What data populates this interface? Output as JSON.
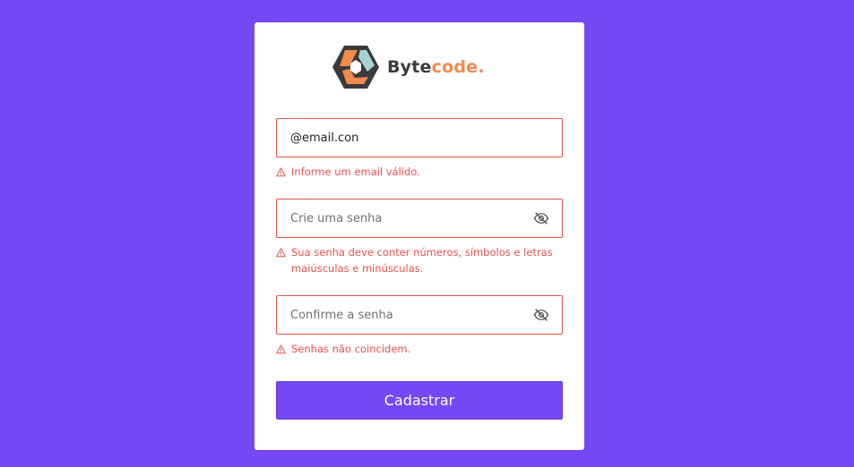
{
  "brand": {
    "name_part1": "Byte",
    "name_part2": "code.",
    "color_dark": "#3b3b3b",
    "color_accent": "#f28a4b",
    "logo_icon": "hexagon-logo-icon"
  },
  "form": {
    "email": {
      "value": "@email.con",
      "error": "Informe um email válido."
    },
    "password": {
      "placeholder": "Crie uma senha",
      "toggle_icon": "eye-off-icon",
      "error": "Sua senha deve conter números, símbolos e letras maiúsculas e minúsculas."
    },
    "confirm": {
      "placeholder": "Confirme a senha",
      "toggle_icon": "eye-off-icon",
      "error": "Senhas não coincidem."
    },
    "submit_label": "Cadastrar"
  },
  "colors": {
    "background": "#7548f3",
    "error": "#e5534b",
    "button": "#7548f3"
  }
}
